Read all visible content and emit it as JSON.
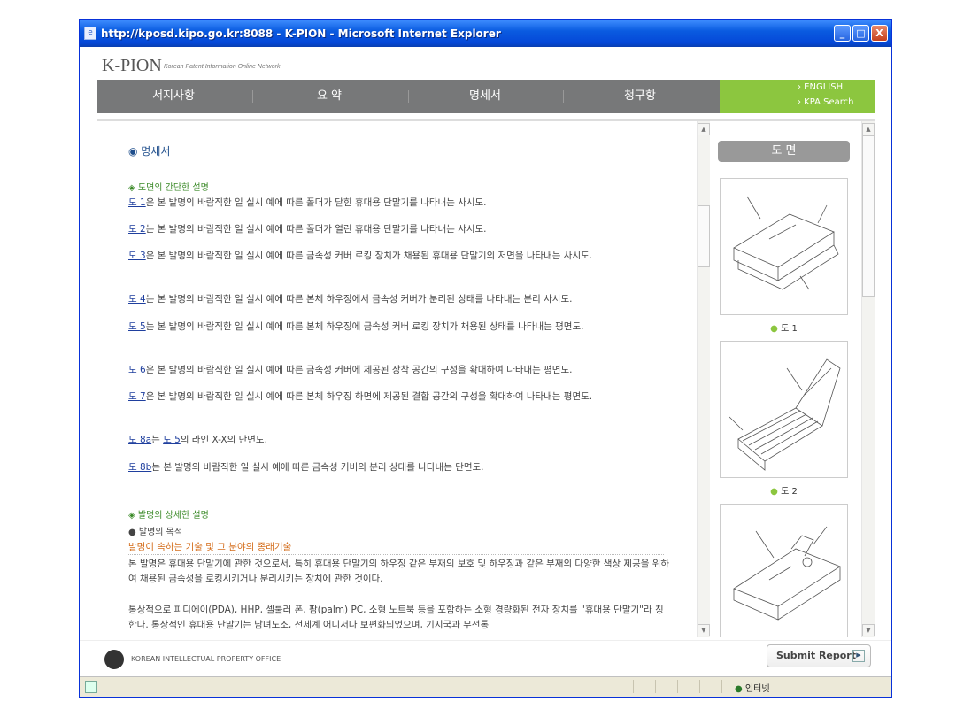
{
  "window": {
    "title": "http://kposd.kipo.go.kr:8088 - K-PION - Microsoft Internet Explorer",
    "minimize": "_",
    "maximize": "□",
    "close": "X"
  },
  "header": {
    "logo": "K-PION",
    "logo_sub": "Korean Patent Information Online Network"
  },
  "nav": {
    "items": [
      {
        "label": "서지사항"
      },
      {
        "label": "요 약"
      },
      {
        "label": "명세서"
      },
      {
        "label": "청구항"
      }
    ],
    "english": "› ENGLISH",
    "kpa": "› KPA Search"
  },
  "main": {
    "section_title": "◉ 명세서",
    "brief_heading": "◈ 도면의 간단한 설명",
    "figures": [
      {
        "link": "도 1",
        "text": "은 본 발명의 바람직한 일 실시 예에 따른 폴더가 닫힌 휴대용 단말기를 나타내는 사시도."
      },
      {
        "link": "도 2",
        "text": "는 본 발명의 바람직한 일 실시 예에 따른 폴더가 열린 휴대용 단말기를 나타내는 사시도."
      },
      {
        "link": "도 3",
        "text": "은 본 발명의 바람직한 일 실시 예에 따른 금속성 커버 로킹 장치가 채용된 휴대용 단말기의 저면을 나타내는 사시도."
      },
      {
        "link": "도 4",
        "text": "는 본 발명의 바람직한 일 실시 예에 따른 본체 하우징에서 금속성 커버가 분리된 상태를 나타내는 분리 사시도."
      },
      {
        "link": "도 5",
        "text": "는 본 발명의 바람직한 일 실시 예에 따른 본체 하우징에 금속성 커버 로킹 장치가 채용된 상태를 나타내는 평면도."
      },
      {
        "link": "도 6",
        "text": "은 본 발명의 바람직한 일 실시 예에 따른 금속성 커버에 제공된 장착 공간의 구성을 확대하여 나타내는 평면도."
      },
      {
        "link": "도 7",
        "text": "은 본 발명의 바람직한 일 실시 예에 따른 본체 하우징 하면에 제공된 결합 공간의 구성을 확대하여 나타내는 평면도."
      },
      {
        "link": "도 8a",
        "text": "는 ",
        "link2": "도 5",
        "text2": "의 라인 X-X의 단면도."
      },
      {
        "link": "도 8b",
        "text": "는 본 발명의 바람직한 일 실시 예에 따른 금속성 커버의 분리 상태를 나타내는 단면도."
      }
    ],
    "detail_heading": "◈ 발명의 상세한 설명",
    "purpose_heading": "● 발명의 목적",
    "field_heading": "발명이 속하는 기술 및 그 분야의 종래기술",
    "para1": "본 발명은 휴대용 단말기에 관한 것으로서, 특히 휴대용 단말기의 하우징 같은 부재의 보호 및 하우징과 같은 부재의 다양한 색상 제공을 위하여 채용된 금속성을 로킹시키거나 분리시키는 장치에 관한 것이다.",
    "para2": "통상적으로 피디에이(PDA), HHP, 셀룰러 폰, 팜(palm) PC, 소형 노트북 등을 포함하는 소형 경량화된 전자 장치를 \"휴대용 단말기\"라 칭한다. 통상적인 휴대용 단말기는 남녀노소, 전세계 어디서나 보편화되었으며, 기지국과 무선통"
  },
  "right": {
    "drawings_button": "도 면",
    "captions": [
      "도 1",
      "도 2"
    ]
  },
  "footer": {
    "org": "KOREAN INTELLECTUAL PROPERTY OFFICE",
    "submit": "Submit Report",
    "submit_arrow": "▶"
  },
  "statusbar": {
    "zone": "인터넷"
  },
  "colors": {
    "titlebar": "#0a5be0",
    "nav": "#777879",
    "nav_green": "#8cc63f",
    "link": "#1f3f9e",
    "orange_heading": "#d46d1b",
    "green_heading": "#3b8a28"
  }
}
